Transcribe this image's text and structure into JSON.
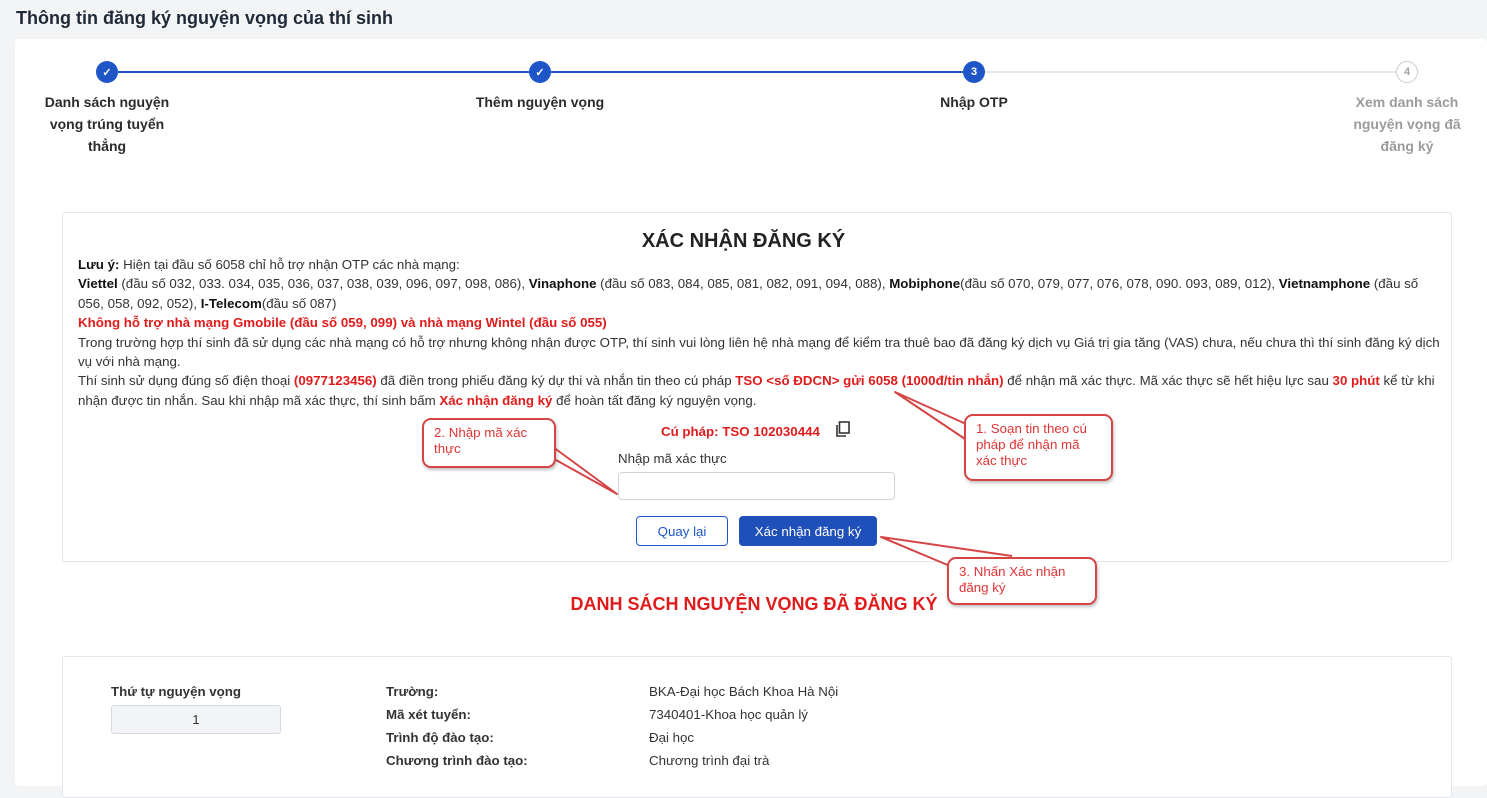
{
  "page_title": "Thông tin đăng ký nguyện vọng của thí sinh",
  "stepper": {
    "steps": [
      {
        "label": "Danh sách nguyện vọng trúng tuyển thẳng",
        "state": "done",
        "mark": "✓"
      },
      {
        "label": "Thêm nguyện vọng",
        "state": "done",
        "mark": "✓"
      },
      {
        "label": "Nhập OTP",
        "state": "active",
        "mark": "3"
      },
      {
        "label": "Xem danh sách nguyện vọng đã đăng ký",
        "state": "pending",
        "mark": "4"
      }
    ]
  },
  "confirm": {
    "title": "XÁC NHẬN ĐĂNG KÝ",
    "note_prefix": "Lưu ý:",
    "note_text": " Hiện tại đầu số 6058 chỉ hỗ trợ nhận OTP các nhà mạng:",
    "carriers": [
      {
        "name": "Viettel",
        "detail": " (đầu số 032, 033. 034, 035, 036, 037, 038, 039, 096, 097, 098, 086), "
      },
      {
        "name": "Vinaphone",
        "detail": " (đầu số 083, 084, 085, 081, 082, 091, 094, 088), "
      },
      {
        "name": "Mobiphone",
        "detail": "(đầu số 070, 079, 077, 076, 078, 090. 093, 089, 012), "
      },
      {
        "name": "Vietnamphone",
        "detail": " (đầu số 056, 058, 092, 052), "
      },
      {
        "name": "I-Telecom",
        "detail": "(đầu số 087)"
      }
    ],
    "unsupported": "Không hỗ trợ nhà mạng Gmobile (đầu số 059, 099) và nhà mạng Wintel (đầu số 055)",
    "vas_note": "Trong trường hợp thí sinh đã sử dụng các nhà mạng có hỗ trợ nhưng không nhận được OTP, thí sinh vui lòng liên hệ nhà mạng để kiểm tra thuê bao đã đăng ký dịch vụ Giá trị gia tăng (VAS) chưa, nếu chưa thì thí sinh đăng ký dịch vụ với nhà mạng.",
    "phone_1": "Thí sinh sử dụng đúng số điện thoại ",
    "phone_number": "(0977123456)",
    "phone_2": " đã điền trong phiếu đăng ký dự thi và nhắn tin theo cú pháp ",
    "sms_syntax": "TSO <số ĐDCN> gửi 6058 (1000đ/tin nhắn)",
    "phone_3": " để nhận mã xác thực. Mã xác thực sẽ hết hiệu lực sau ",
    "expiry": "30 phút",
    "phone_4": " kể từ khi nhận được tin nhắn. Sau khi nhập mã xác thực, thí sinh bấm ",
    "confirm_word": "Xác nhận đăng ký",
    "phone_5": " để hoàn tất đăng ký nguyện vọng.",
    "syntax_line": "Cú pháp: TSO 102030444",
    "otp_label": "Nhập mã xác thực",
    "otp_value": "",
    "back_label": "Quay lại",
    "submit_label": "Xác nhận đăng ký"
  },
  "callouts": {
    "c1": "1. Soạn tin theo cú pháp để nhận mã xác thực",
    "c2": "2. Nhập mã xác thực",
    "c3": "3. Nhấn Xác nhận đăng ký"
  },
  "list": {
    "title": "DANH SÁCH NGUYỆN VỌNG ĐÃ ĐĂNG KÝ",
    "order_label": "Thứ tự nguyện vọng",
    "order_value": "1",
    "fields": [
      {
        "key": "Trường:",
        "value": "BKA-Đại học Bách Khoa Hà Nội"
      },
      {
        "key": "Mã xét tuyển:",
        "value": "7340401-Khoa học quản lý"
      },
      {
        "key": "Trình độ đào tạo:",
        "value": "Đại học"
      },
      {
        "key": "Chương trình đào tạo:",
        "value": "Chương trình đại trà"
      }
    ]
  },
  "colors": {
    "primary": "#1f56c7",
    "danger": "#e01b1b",
    "callout_border": "#d64545"
  }
}
